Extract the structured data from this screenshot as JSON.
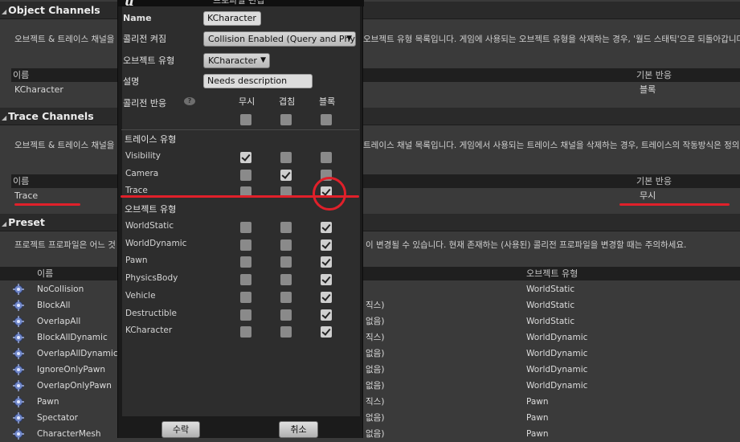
{
  "object_channels": {
    "header": "Object Channels",
    "desc_left": "오브젝트 & 트레이스 채널을",
    "desc_right": "오브젝트 유형 목록입니다. 게임에 사용되는 오브젝트 유형을 삭제하는 경우, '월드 스태틱'으로 되돌아갑니다.",
    "col_name": "이름",
    "col_response": "기본 반응",
    "row_name": "KCharacter",
    "row_response": "블록"
  },
  "trace_channels": {
    "header": "Trace Channels",
    "desc_left": "오브젝트 & 트레이스 채널을",
    "desc_right": "트레이스 채널 목록입니다. 게임에서 사용되는 트레이스 채널을 삭제하는 경우, 트레이스의 작동방식은 정의",
    "col_name": "이름",
    "col_response": "기본 반응",
    "row_name": "Trace",
    "row_response": "무시"
  },
  "preset": {
    "header": "Preset",
    "desc_left": "프로젝트 프로파일은 어느 것",
    "desc_right": "이 변경될 수 있습니다. 현재 존재하는 (사용된) 콜리전 프로파일을 변경할 때는 주의하세요.",
    "col_name": "이름",
    "col_type": "오브젝트 유형",
    "rows": [
      {
        "name": "NoCollision",
        "mid": "",
        "type": "WorldStatic"
      },
      {
        "name": "BlockAll",
        "mid": "직스)",
        "type": "WorldStatic"
      },
      {
        "name": "OverlapAll",
        "mid": "없음)",
        "type": "WorldStatic"
      },
      {
        "name": "BlockAllDynamic",
        "mid": "직스)",
        "type": "WorldDynamic"
      },
      {
        "name": "OverlapAllDynamic",
        "mid": "없음)",
        "type": "WorldDynamic"
      },
      {
        "name": "IgnoreOnlyPawn",
        "mid": "없음)",
        "type": "WorldDynamic"
      },
      {
        "name": "OverlapOnlyPawn",
        "mid": "없음)",
        "type": "WorldDynamic"
      },
      {
        "name": "Pawn",
        "mid": "직스)",
        "type": "Pawn"
      },
      {
        "name": "Spectator",
        "mid": "없음)",
        "type": "Pawn"
      },
      {
        "name": "CharacterMesh",
        "mid": "없음)",
        "type": "Pawn"
      }
    ]
  },
  "dialog": {
    "logo": "u",
    "title": "프로파일 편집",
    "name_label": "Name",
    "name_value": "KCharacter",
    "collision_label": "콜리전 켜짐",
    "collision_value": "Collision Enabled (Query and Physics)",
    "object_type_label": "오브젝트 유형",
    "object_type_value": "KCharacter",
    "desc_label": "설명",
    "desc_value": "Needs description",
    "response_label": "콜리전 반응",
    "help_glyph": "?",
    "col_ignore": "무시",
    "col_overlap": "겹침",
    "col_block": "블록",
    "trace_type_label": "트레이스 유형",
    "object_type_section_label": "오브젝트 유형",
    "trace_rows": [
      {
        "name": "Visibility",
        "ignore": true,
        "overlap": false,
        "block": false
      },
      {
        "name": "Camera",
        "ignore": false,
        "overlap": true,
        "block": false
      },
      {
        "name": "Trace",
        "ignore": false,
        "overlap": false,
        "block": true
      }
    ],
    "object_rows": [
      {
        "name": "WorldStatic",
        "ignore": false,
        "overlap": false,
        "block": true
      },
      {
        "name": "WorldDynamic",
        "ignore": false,
        "overlap": false,
        "block": true
      },
      {
        "name": "Pawn",
        "ignore": false,
        "overlap": false,
        "block": true
      },
      {
        "name": "PhysicsBody",
        "ignore": false,
        "overlap": false,
        "block": true
      },
      {
        "name": "Vehicle",
        "ignore": false,
        "overlap": false,
        "block": true
      },
      {
        "name": "Destructible",
        "ignore": false,
        "overlap": false,
        "block": true
      },
      {
        "name": "KCharacter",
        "ignore": false,
        "overlap": false,
        "block": true
      }
    ],
    "accept_label": "수락",
    "cancel_label": "취소"
  },
  "colors": {
    "annotation": "#e0202a",
    "background": "#3a3a3a",
    "dialog_bg": "#2d2d2d"
  }
}
